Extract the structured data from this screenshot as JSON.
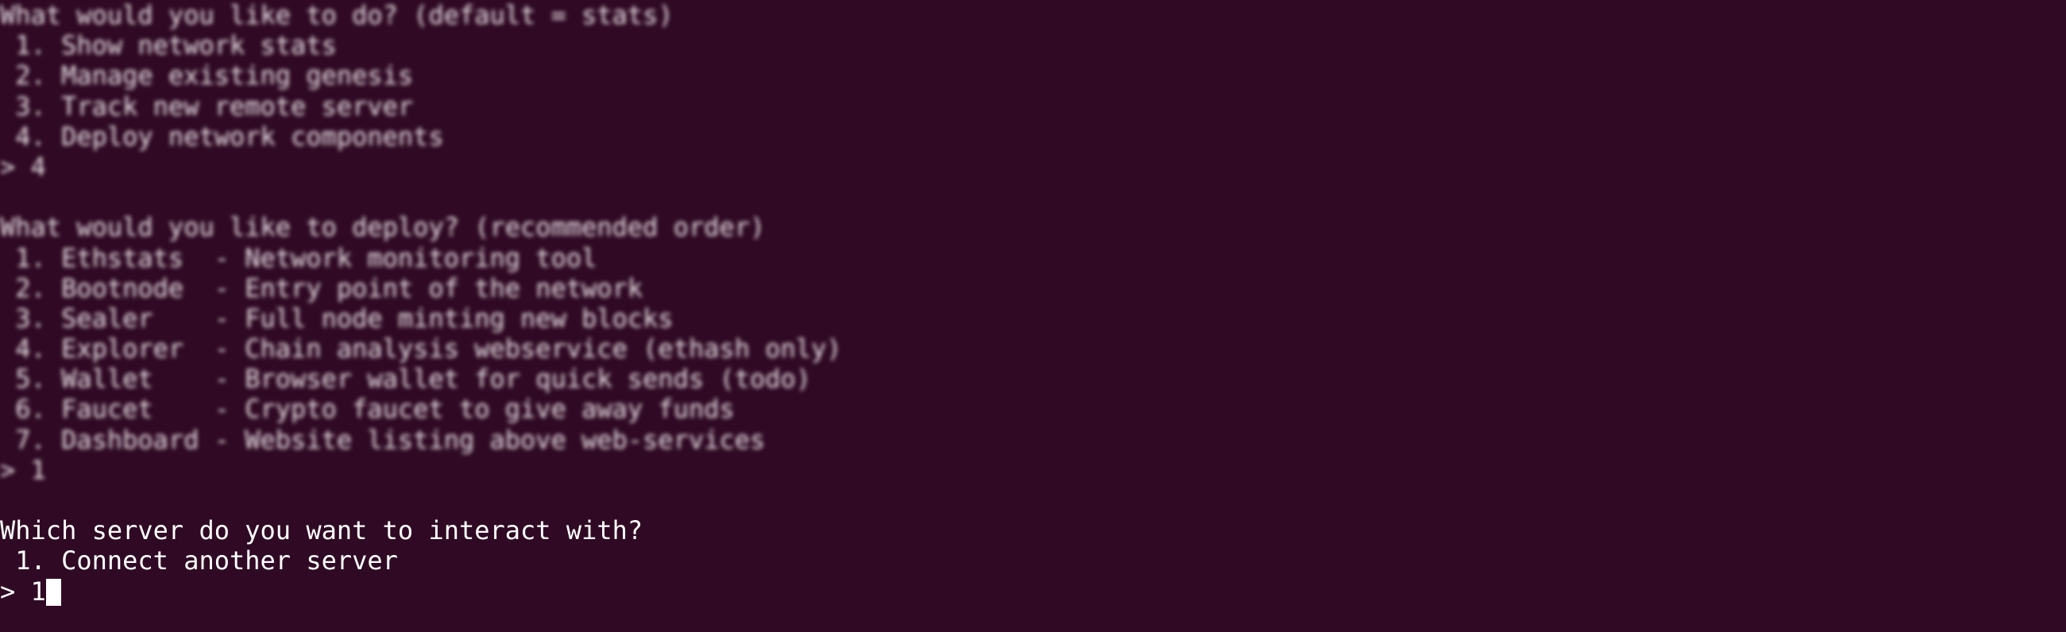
{
  "terminal": {
    "history": [
      "What would you like to do? (default = stats)",
      " 1. Show network stats",
      " 2. Manage existing genesis",
      " 3. Track new remote server",
      " 4. Deploy network components",
      "> 4",
      "",
      "What would you like to deploy? (recommended order)",
      " 1. Ethstats  - Network monitoring tool",
      " 2. Bootnode  - Entry point of the network",
      " 3. Sealer    - Full node minting new blocks",
      " 4. Explorer  - Chain analysis webservice (ethash only)",
      " 5. Wallet    - Browser wallet for quick sends (todo)",
      " 6. Faucet    - Crypto faucet to give away funds",
      " 7. Dashboard - Website listing above web-services",
      "> 1",
      ""
    ],
    "current_question": "Which server do you want to interact with?",
    "current_options": [
      " 1. Connect another server"
    ],
    "prompt_symbol": "> ",
    "input_value": "1",
    "background_color": "#300a24",
    "text_color": "#ffffff"
  }
}
